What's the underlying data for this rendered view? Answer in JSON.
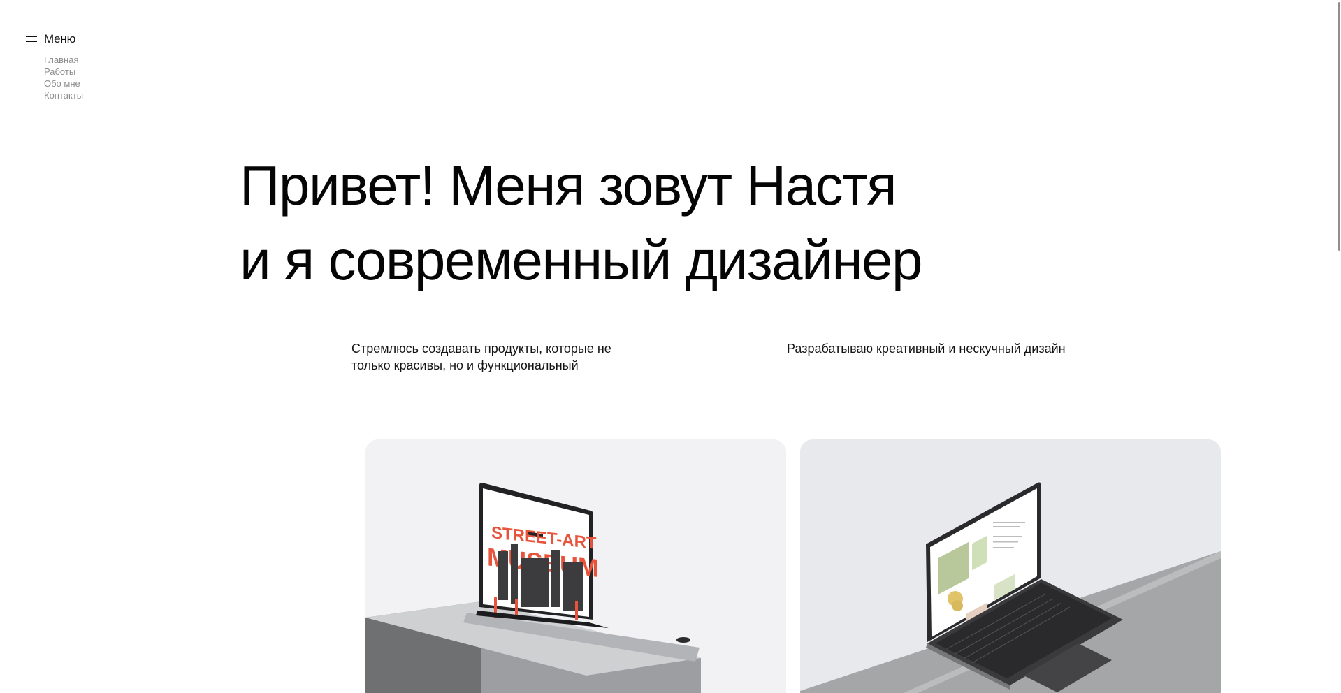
{
  "menu": {
    "label": "Меню",
    "items": [
      {
        "label": "Главная"
      },
      {
        "label": "Работы"
      },
      {
        "label": "Обо мне"
      },
      {
        "label": "Контакты"
      }
    ]
  },
  "hero": {
    "line1": "Привет! Меня зовут Настя",
    "line2": "и я современный дизайнер"
  },
  "subtitles": {
    "left_line1": "Стремлюсь создавать продукты, которые не",
    "left_line2": "только красивы, но и функциональный",
    "right": "Разрабатываю креативный и нескучный дизайн"
  },
  "cards": [
    {
      "screen_title_1": "STREET-ART",
      "screen_title_2": "MUSEUM"
    },
    {
      "screen_title_1": "",
      "screen_title_2": ""
    }
  ],
  "colors": {
    "accent": "#e8533b",
    "text": "#050505",
    "muted": "#8d8d8d"
  }
}
